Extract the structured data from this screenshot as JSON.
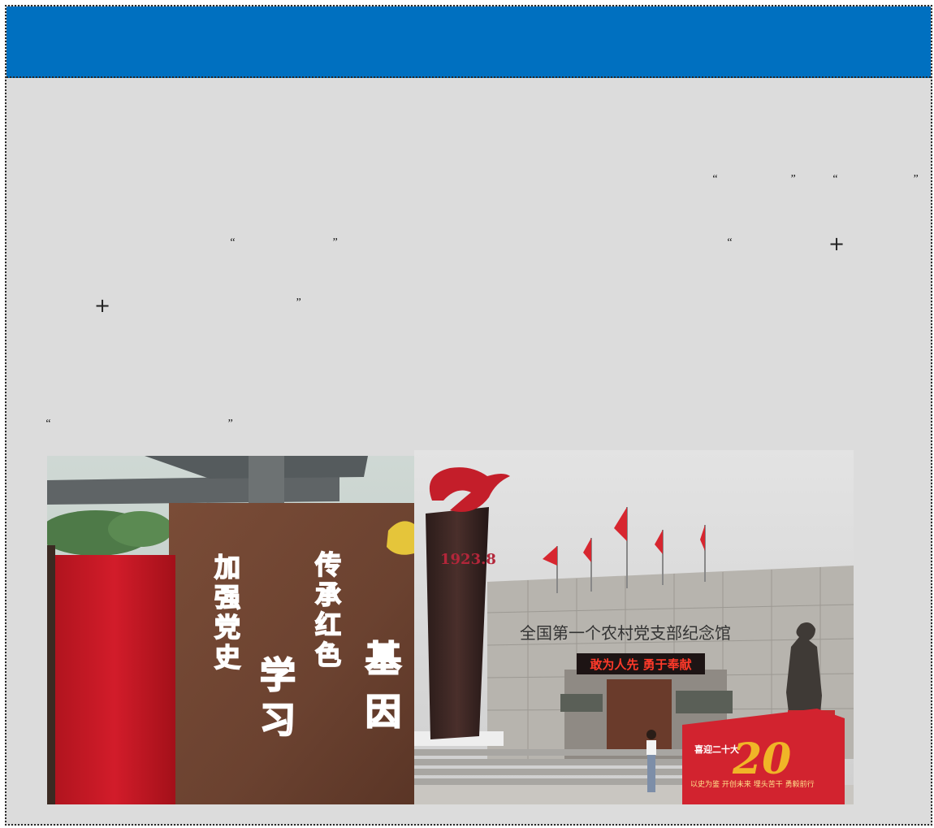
{
  "header": {
    "color": "#0070c0"
  },
  "marks": {
    "q1": "“",
    "q2": "”",
    "q3": "“",
    "q4": "”",
    "q5": "“",
    "q6": "”",
    "q7": "“",
    "q8": "”",
    "q9": "“",
    "q10": "”",
    "p1": "+",
    "p2": "+"
  },
  "photo_left": {
    "col1": "加强党史",
    "col2": "传承红色",
    "col3": "学习",
    "col4": "基因"
  },
  "photo_right": {
    "tower_year": "1923.8",
    "building_name": "全国第一个农村党支部纪念馆",
    "led_sign": "敢为人先  勇于奉献",
    "board_title": "喜迎二十大",
    "board_big": "20",
    "board_slogan": "以史为鉴 开创未来 埋头苦干 勇毅前行"
  }
}
